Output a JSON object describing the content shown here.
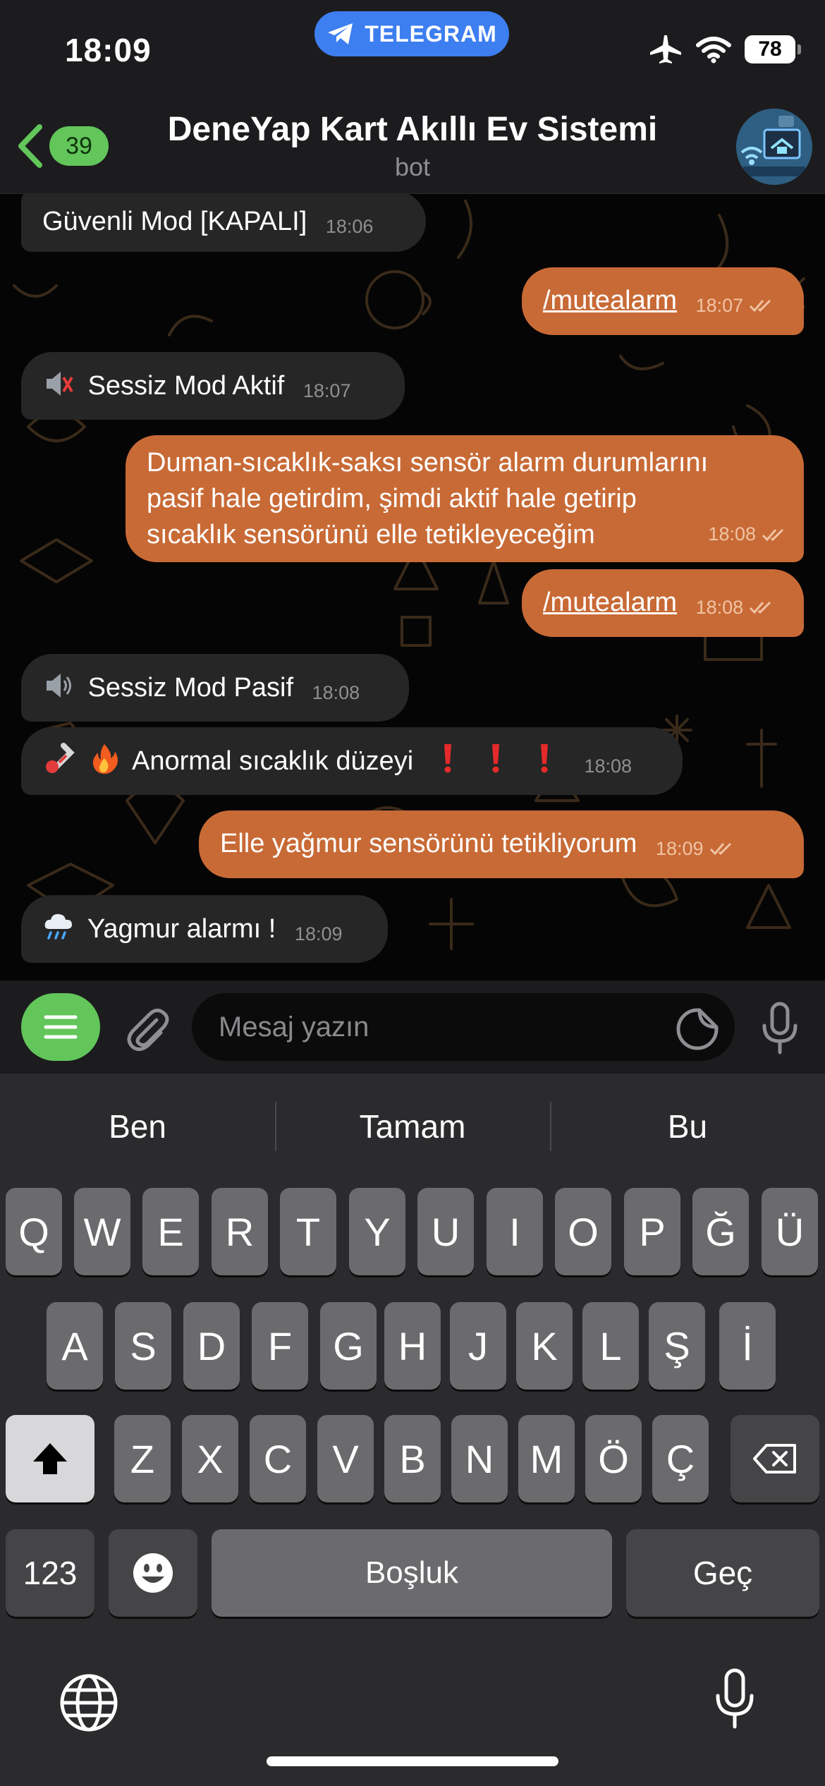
{
  "status_bar": {
    "time": "18:09",
    "source_app": "TELEGRAM",
    "battery": "78",
    "icons": [
      "airplane-icon",
      "wifi-icon",
      "battery-icon"
    ]
  },
  "header": {
    "back_count": "39",
    "title": "DeneYap Kart Akıllı Ev Sistemi",
    "subtitle": "bot"
  },
  "messages": [
    {
      "side": "in",
      "text": "Güvenli Mod [KAPALI]",
      "time": "18:06"
    },
    {
      "side": "out",
      "text": "/mutealarm",
      "time": "18:07",
      "read": true
    },
    {
      "side": "in",
      "emoji": "muted-speaker",
      "text": "Sessiz Mod Aktif",
      "time": "18:07"
    },
    {
      "side": "out",
      "lines": [
        "Duman-sıcaklık-saksı sensör alarm durumlarını",
        "pasif hale getirdim, şimdi aktif hale getirip",
        "sıcaklık sensörünü elle tetikleyeceğim"
      ],
      "time": "18:08",
      "read": true
    },
    {
      "side": "out",
      "text": "/mutealarm",
      "time": "18:08",
      "read": true
    },
    {
      "side": "in",
      "emoji": "speaker",
      "text": "Sessiz Mod Pasif",
      "time": "18:08"
    },
    {
      "side": "in",
      "emoji": "thermometer-fire",
      "text": "Anormal sıcaklık düzeyi",
      "time": "18:08"
    },
    {
      "side": "out",
      "text": "Elle yağmur sensörünü tetikliyorum",
      "time": "18:09",
      "read": true
    },
    {
      "side": "in",
      "emoji": "rain-cloud",
      "text": "Yagmur alarmı !",
      "time": "18:09"
    }
  ],
  "input": {
    "placeholder": "Mesaj yazın"
  },
  "keyboard": {
    "suggestions": [
      "Ben",
      "Tamam",
      "Bu"
    ],
    "row1": [
      "Q",
      "W",
      "E",
      "R",
      "T",
      "Y",
      "U",
      "I",
      "O",
      "P",
      "Ğ",
      "Ü"
    ],
    "row2": [
      "A",
      "S",
      "D",
      "F",
      "G",
      "H",
      "J",
      "K",
      "L",
      "Ş",
      "İ"
    ],
    "row3": [
      "Z",
      "X",
      "C",
      "V",
      "B",
      "N",
      "M",
      "Ö",
      "Ç"
    ],
    "numbers_label": "123",
    "space_label": "Boşluk",
    "return_label": "Geç"
  },
  "colors": {
    "incoming_bubble": "#262626",
    "outgoing_bubble": "#c86a36",
    "accent_green": "#62c65b",
    "telegram_blue": "#3d7ef0"
  }
}
